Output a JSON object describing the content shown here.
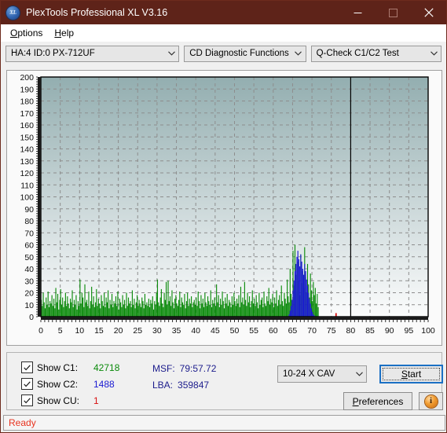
{
  "window": {
    "title": "PlexTools Professional XL V3.16",
    "icon_label": "XL",
    "icon_name": "plextools-xl-icon",
    "titlebar_color": "#5e2319",
    "minimize_label": "Minimize",
    "maximize_label": "Maximize",
    "close_label": "Close"
  },
  "menu": {
    "items": [
      {
        "label": "Options",
        "accel": "O"
      },
      {
        "label": "Help",
        "accel": "H"
      }
    ]
  },
  "selectors": {
    "drive": "HA:4 ID:0  PX-712UF",
    "function": "CD Diagnostic Functions",
    "test": "Q-Check C1/C2 Test"
  },
  "controls": {
    "checkboxes": [
      {
        "label": "Show C1:",
        "value": "42718",
        "color": "#0a8a0a",
        "checked": true
      },
      {
        "label": "Show C2:",
        "value": "1488",
        "color": "#1a1ad2",
        "checked": true
      },
      {
        "label": "Show CU:",
        "value": "1",
        "color": "#d81010",
        "checked": true
      }
    ],
    "readouts": [
      {
        "key": "MSF:",
        "value": "79:57.72"
      },
      {
        "key": "LBA:",
        "value": "359847"
      }
    ],
    "speed": "10-24 X CAV",
    "start_label": "Start",
    "start_accel": "S",
    "preferences_label": "Preferences",
    "preferences_accel": "P",
    "info_label": "i"
  },
  "status": {
    "text": "Ready",
    "color": "#e8331f"
  },
  "chart_data": {
    "type": "bar",
    "title": "",
    "xlabel": "",
    "ylabel": "",
    "xlim": [
      0,
      100
    ],
    "ylim": [
      0,
      200
    ],
    "xticks": [
      0,
      5,
      10,
      15,
      20,
      25,
      30,
      35,
      40,
      45,
      50,
      55,
      60,
      65,
      70,
      75,
      80,
      85,
      90,
      95,
      100
    ],
    "yticks": [
      0,
      10,
      20,
      30,
      40,
      50,
      60,
      70,
      80,
      90,
      100,
      110,
      120,
      130,
      140,
      150,
      160,
      170,
      180,
      190,
      200
    ],
    "grid": true,
    "legend_position": "external-bottom-left",
    "plot_bg_top": "#93aeb0",
    "plot_bg_bottom": "#fbfcfc",
    "data_end_marker_x": 80,
    "series": [
      {
        "name": "C1",
        "color": "#0a8a0a",
        "total": 42718,
        "values": [
          14,
          9,
          20,
          12,
          7,
          16,
          10,
          21,
          8,
          13,
          11,
          18,
          9,
          15,
          7,
          24,
          12,
          19,
          6,
          14,
          23,
          10,
          16,
          8,
          13,
          20,
          9,
          17,
          11,
          7,
          15,
          12,
          22,
          8,
          14,
          10,
          18,
          6,
          13,
          9,
          31,
          11,
          20,
          16,
          8,
          27,
          12,
          14,
          9,
          21,
          7,
          13,
          25,
          10,
          17,
          8,
          12,
          23,
          9,
          15,
          11,
          7,
          18,
          13,
          9,
          20,
          8,
          16,
          12,
          22,
          7,
          14,
          10,
          19,
          8,
          13,
          11,
          17,
          9,
          21,
          6,
          15,
          12,
          8,
          18,
          10,
          14,
          7,
          20,
          9,
          16,
          11,
          13,
          8,
          22,
          10,
          15,
          7,
          12,
          18,
          9,
          14,
          11,
          8,
          16,
          13,
          7,
          19,
          10,
          12,
          9,
          15,
          8,
          14,
          11,
          17,
          6,
          13,
          10,
          20,
          31,
          12,
          9,
          16,
          23,
          11,
          8,
          20,
          14,
          29,
          10,
          30,
          13,
          17,
          9,
          22,
          12,
          7,
          15,
          18,
          11,
          9,
          14,
          21,
          8,
          16,
          12,
          10,
          19,
          7,
          13,
          20,
          9,
          15,
          11,
          17,
          8,
          12,
          14,
          10,
          16,
          9,
          21,
          13,
          7,
          18,
          11,
          15,
          8,
          20,
          12,
          9,
          17,
          13,
          10,
          22,
          8,
          14,
          11,
          16,
          9,
          27,
          12,
          18,
          8,
          15,
          10,
          21,
          13,
          7,
          16,
          11,
          19,
          9,
          14,
          12,
          8,
          17,
          10,
          20,
          13,
          9,
          15,
          11,
          18,
          8,
          25,
          12,
          16,
          10,
          29,
          14,
          9,
          20,
          12,
          17,
          8,
          13,
          22,
          11,
          15,
          9,
          18,
          12,
          7,
          20,
          10,
          14,
          16,
          8,
          21,
          11,
          9,
          17,
          13,
          24,
          10,
          15,
          12,
          19,
          8,
          16,
          11,
          22,
          9,
          14,
          18,
          10,
          26,
          13,
          9,
          20,
          15,
          11,
          31,
          17,
          12,
          40,
          19,
          14,
          55,
          26,
          60,
          35,
          21,
          46,
          30,
          18,
          52,
          28,
          38,
          24,
          58,
          33,
          20,
          44,
          27,
          16,
          36,
          22,
          13,
          29,
          18,
          24,
          11,
          19,
          8,
          0,
          0,
          0,
          0,
          0,
          0,
          0,
          0,
          0,
          0,
          0,
          0,
          0,
          0,
          0,
          0,
          0,
          0,
          0,
          0,
          0,
          0,
          0,
          0,
          0,
          0,
          0,
          0,
          0,
          0,
          0,
          0,
          0,
          0,
          0,
          0,
          0,
          0,
          0,
          0,
          0,
          0,
          0,
          0,
          0,
          0,
          0,
          0,
          0,
          0,
          0,
          0,
          0,
          0,
          0,
          0,
          0,
          0,
          0,
          0,
          0,
          0,
          0,
          0,
          0,
          0,
          0,
          0,
          0,
          0,
          0,
          0,
          0,
          0,
          0,
          0,
          0,
          0,
          0,
          0,
          0,
          0,
          0,
          0,
          0,
          0,
          0,
          0,
          0,
          0,
          0,
          0,
          0,
          0,
          0,
          0,
          0,
          0,
          0,
          0,
          0,
          0,
          0,
          0,
          0,
          0,
          0,
          0,
          0,
          0,
          0,
          0,
          0
        ]
      },
      {
        "name": "C2",
        "color": "#1a1ad2",
        "total": 1488,
        "values": [
          0,
          0,
          0,
          0,
          0,
          0,
          0,
          0,
          0,
          0,
          0,
          0,
          0,
          0,
          0,
          0,
          0,
          0,
          0,
          0,
          0,
          0,
          0,
          0,
          0,
          0,
          0,
          0,
          0,
          0,
          0,
          0,
          0,
          0,
          0,
          0,
          0,
          0,
          0,
          0,
          0,
          0,
          0,
          0,
          0,
          0,
          0,
          0,
          0,
          0,
          0,
          0,
          0,
          0,
          0,
          0,
          0,
          0,
          0,
          0,
          0,
          0,
          0,
          0,
          0,
          0,
          0,
          0,
          0,
          0,
          0,
          0,
          0,
          0,
          0,
          0,
          0,
          0,
          0,
          0,
          0,
          0,
          0,
          0,
          0,
          0,
          0,
          0,
          0,
          0,
          0,
          0,
          0,
          0,
          0,
          0,
          0,
          0,
          0,
          0,
          0,
          0,
          0,
          0,
          0,
          0,
          0,
          0,
          0,
          0,
          0,
          0,
          0,
          0,
          0,
          0,
          0,
          0,
          0,
          0,
          0,
          0,
          0,
          0,
          0,
          0,
          0,
          0,
          0,
          0,
          0,
          0,
          0,
          0,
          0,
          0,
          0,
          0,
          0,
          0,
          0,
          0,
          0,
          0,
          0,
          0,
          0,
          0,
          0,
          0,
          0,
          0,
          0,
          0,
          0,
          0,
          0,
          0,
          0,
          0,
          0,
          0,
          0,
          0,
          0,
          0,
          0,
          0,
          0,
          0,
          0,
          0,
          0,
          0,
          0,
          0,
          0,
          0,
          0,
          0,
          0,
          0,
          0,
          0,
          0,
          0,
          0,
          0,
          0,
          0,
          0,
          0,
          0,
          0,
          0,
          0,
          0,
          0,
          0,
          0,
          0,
          0,
          0,
          0,
          0,
          0,
          0,
          0,
          0,
          0,
          0,
          0,
          0,
          0,
          0,
          0,
          0,
          0,
          0,
          0,
          0,
          0,
          0,
          0,
          0,
          0,
          0,
          0,
          0,
          0,
          0,
          0,
          0,
          0,
          0,
          0,
          0,
          0,
          0,
          0,
          0,
          0,
          0,
          0,
          0,
          0,
          0,
          0,
          0,
          0,
          0,
          0,
          0,
          0,
          0,
          0,
          2,
          5,
          9,
          14,
          22,
          30,
          38,
          44,
          50,
          55,
          48,
          42,
          52,
          46,
          40,
          35,
          44,
          38,
          31,
          26,
          20,
          15,
          11,
          7,
          4,
          2,
          1,
          0,
          0,
          0,
          0,
          0,
          0,
          0,
          0,
          0,
          0,
          0,
          0,
          0,
          0,
          0,
          0,
          0,
          0,
          0,
          0,
          0,
          0,
          0,
          0,
          0,
          0,
          0,
          0,
          0,
          0,
          0,
          0,
          0,
          0,
          0,
          0,
          0,
          0,
          0,
          0,
          0,
          0,
          0,
          0,
          0,
          0,
          0,
          0,
          0,
          0,
          0,
          0,
          0,
          0,
          0,
          0,
          0,
          0,
          0,
          0,
          0,
          0,
          0,
          0,
          0,
          0,
          0,
          0,
          0,
          0,
          0,
          0,
          0,
          0,
          0,
          0,
          0,
          0,
          0,
          0,
          0,
          0,
          0,
          0,
          0,
          0,
          0,
          0,
          0,
          0,
          0,
          0,
          0,
          0,
          0,
          0,
          0,
          0,
          0,
          0,
          0,
          0,
          0,
          0,
          0,
          0,
          0,
          0,
          0,
          0,
          0,
          0,
          0,
          0,
          0,
          0,
          0
        ]
      },
      {
        "name": "CU",
        "color": "#d81010",
        "total": 1,
        "points": [
          {
            "x": 76.2,
            "y": 3
          }
        ]
      }
    ]
  }
}
